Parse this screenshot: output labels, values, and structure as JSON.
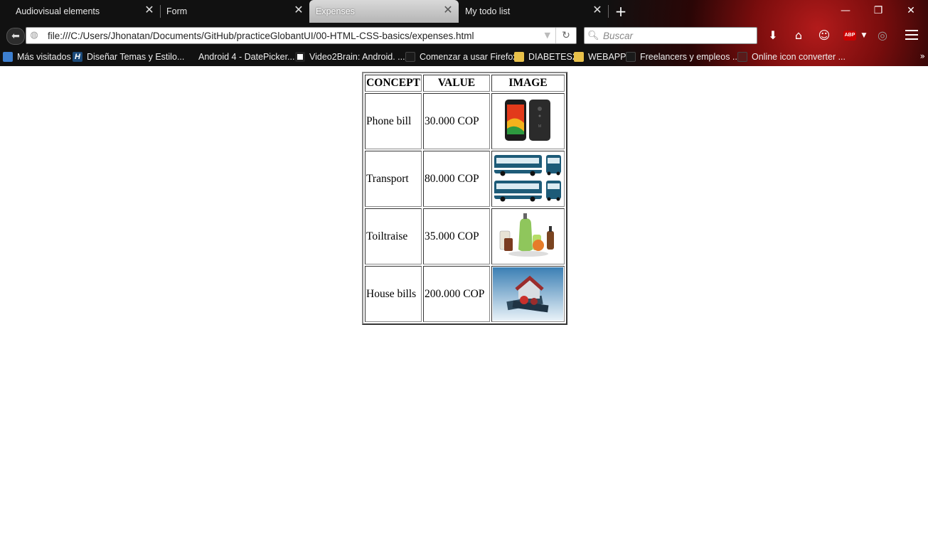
{
  "browser": {
    "tabs": [
      {
        "label": "Audiovisual elements",
        "active": false
      },
      {
        "label": "Form",
        "active": false
      },
      {
        "label": "Expenses",
        "active": true
      },
      {
        "label": "My todo list",
        "active": false
      }
    ],
    "url": "file:///C:/Users/Jhonatan/Documents/GitHub/practiceGlobantUI/00-HTML-CSS-basics/expenses.html",
    "search_placeholder": "Buscar",
    "bookmarks": [
      "Más visitados",
      "Diseñar Temas y Estilo...",
      "Android 4 - DatePicker...",
      "Video2Brain: Android. ...",
      "Comenzar a usar Firefox",
      "DIABETES2",
      "WEBAPP",
      "Freelancers y empleos ...",
      "Online icon converter ..."
    ],
    "abp_label": "ABP"
  },
  "table": {
    "headers": [
      "CONCEPT",
      "VALUE",
      "IMAGE"
    ],
    "rows": [
      {
        "concept": "Phone bill",
        "value": "30.000 COP",
        "image": "smartphones-image"
      },
      {
        "concept": "Transport",
        "value": "80.000 COP",
        "image": "buses-image"
      },
      {
        "concept": "Toiltraise",
        "value": "35.000 COP",
        "image": "toiletries-image"
      },
      {
        "concept": "House bills",
        "value": "200.000 COP",
        "image": "house-money-image"
      }
    ]
  }
}
